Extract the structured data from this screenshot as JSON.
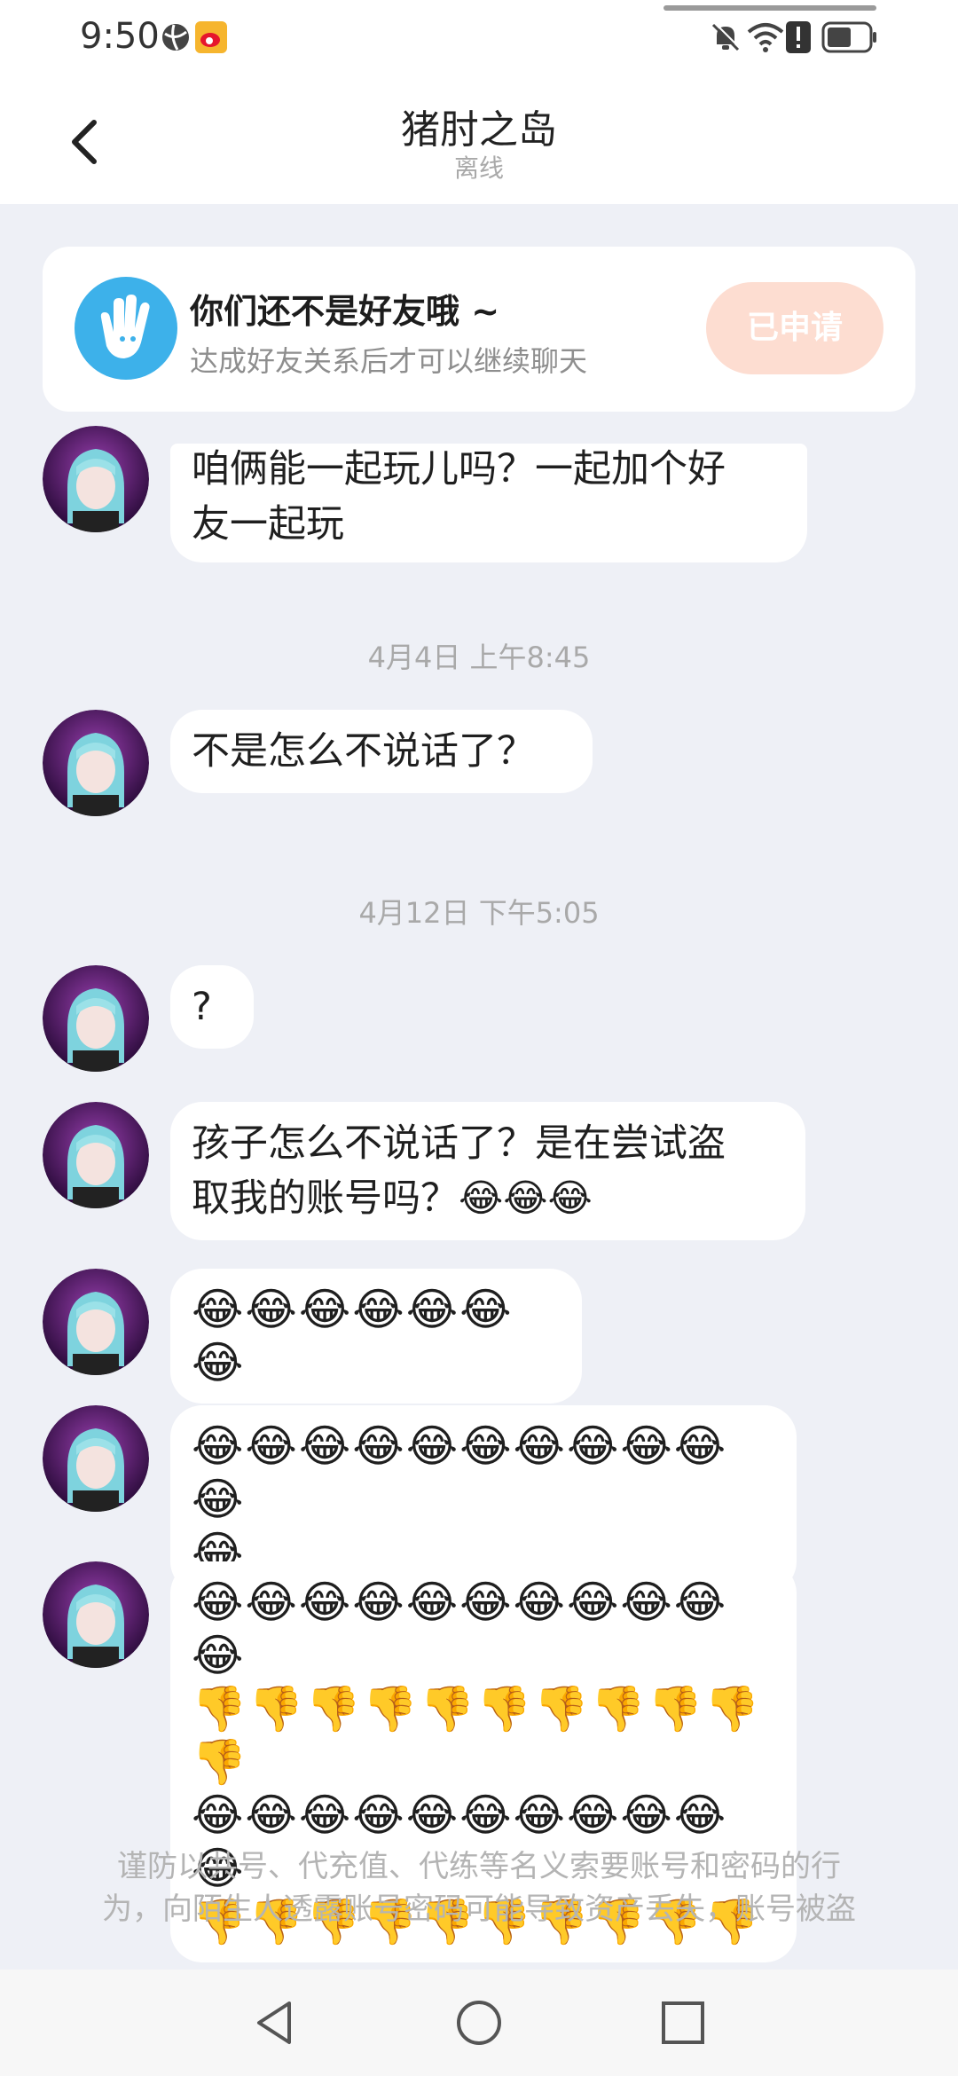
{
  "status_bar": {
    "time": "9:50",
    "icons": [
      "globe-icon",
      "weibo-icon",
      "bell-muted-icon",
      "wifi-icon",
      "alert-icon",
      "battery-icon"
    ]
  },
  "header": {
    "title": "猪肘之岛",
    "status": "离线",
    "back_icon": "chevron-left-icon"
  },
  "friend_banner": {
    "title": "你们还不是好友哦 ~",
    "subtitle": "达成好友关系后才可以继续聊天",
    "button_label": "已申请",
    "icon": "waving-hand-icon"
  },
  "messages": [
    {
      "type": "text",
      "text_lines": [
        "咱俩能一起玩儿吗？一起加个好",
        "友一起玩"
      ]
    },
    {
      "type": "timestamp",
      "text": "4月4日 上午8:45"
    },
    {
      "type": "text",
      "text_lines": [
        "不是怎么不说话了？"
      ]
    },
    {
      "type": "timestamp",
      "text": "4月12日 下午5:05"
    },
    {
      "type": "text",
      "text_lines": [
        "?"
      ]
    },
    {
      "type": "text",
      "text_lines": [
        "孩子怎么不说话了？是在尝试盗",
        "取我的账号吗？😂😂😂"
      ]
    },
    {
      "type": "text",
      "text_lines": [
        "😂😂😂😂😂😂😂"
      ]
    },
    {
      "type": "text",
      "text_lines": [
        "😂😂😂😂😂😂😂😂😂😂😂",
        "😂"
      ]
    },
    {
      "type": "text",
      "text_lines": [
        "😂😂😂😂😂😂😂😂😂😂😂",
        "👎👎👎👎👎👎👎👎👎👎👎",
        "😂😂😂😂😂😂😂😂😂😂😂",
        "👎👎👎👎👎👎👎👎👎👎"
      ]
    }
  ],
  "notice": {
    "lines": [
      "谨防以共号、代充值、代练等名义索要账号和密码的行",
      "为，向陌生人透露账号密码可能导致资产丢失，账号被盗"
    ]
  },
  "nav_bar": {
    "buttons": [
      "back-triangle-icon",
      "home-circle-icon",
      "recents-square-icon"
    ]
  },
  "colors": {
    "background": "#eef0f6",
    "apply_button": "#fdddd1",
    "banner_icon": "#3db1ea"
  }
}
